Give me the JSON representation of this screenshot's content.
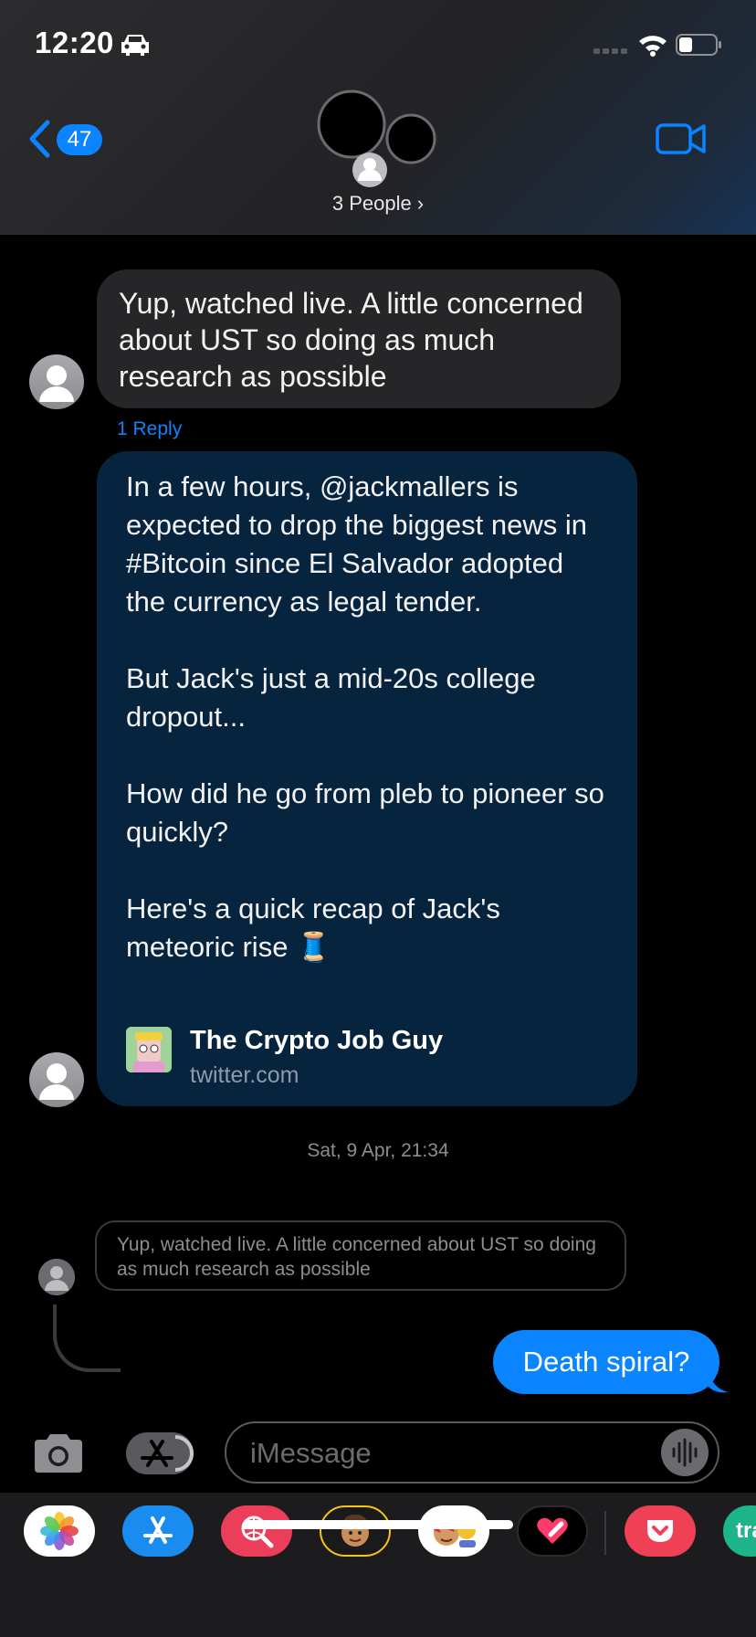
{
  "status_bar": {
    "time": "12:20"
  },
  "header": {
    "back_count": "47",
    "group_label": "3 People ›"
  },
  "messages": [
    {
      "text": "Yup, watched live. A little concerned about UST so doing as much research as possible",
      "reply_count": "1 Reply"
    },
    {
      "paragraphs": [
        "In a few hours, @jackmallers is expected to drop the biggest news in #Bitcoin since El Salvador adopted the currency as legal tender.",
        "But Jack's just a mid-20s college dropout...",
        "How did he go from pleb to pioneer so quickly?",
        "Here's a quick recap of Jack's meteoric rise 🧵"
      ],
      "link_title": "The Crypto Job Guy",
      "link_domain": "twitter.com"
    }
  ],
  "timestamp": "Sat, 9 Apr, 21:34",
  "quoted_reply": "Yup, watched live. A little concerned about UST so doing as much research as possible",
  "sent_message": "Death spiral?",
  "input": {
    "placeholder": "iMessage"
  },
  "app_drawer": {
    "partial_app_label": "tra"
  },
  "colors": {
    "accent": "#0a84ff",
    "incoming_bubble": "#262628",
    "link_bubble": "#07243f"
  }
}
